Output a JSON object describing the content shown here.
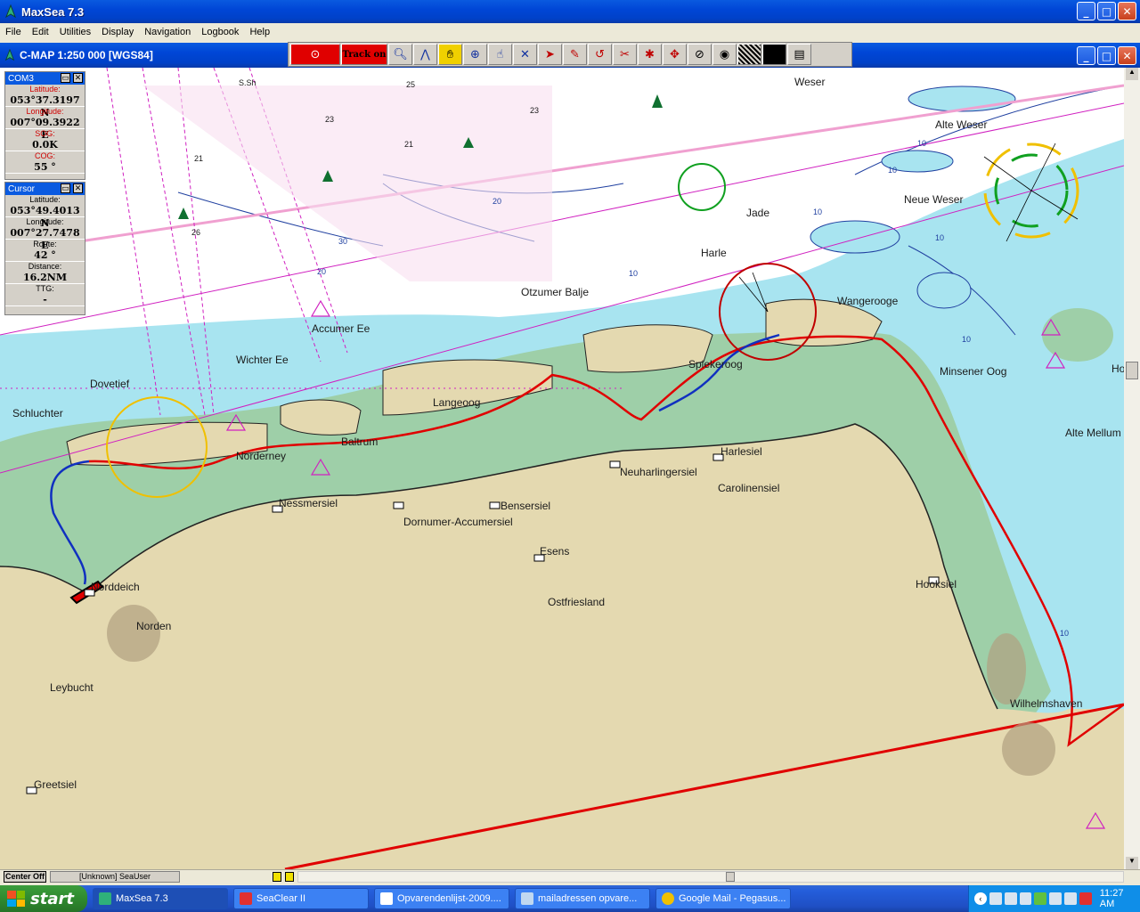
{
  "window": {
    "title": "MaxSea 7.3",
    "minimize": "_",
    "maximize": "□",
    "close": "✕"
  },
  "menu": [
    "File",
    "Edit",
    "Utilities",
    "Display",
    "Navigation",
    "Logbook",
    "Help"
  ],
  "child_window": {
    "title": "C-MAP  1:250 000 [WGS84]"
  },
  "toolbar": {
    "track_label": "Track on"
  },
  "com_panel": {
    "title": "COM3",
    "latitude_label": "Latitude:",
    "latitude": "053°37.3197 N",
    "longitude_label": "Longitude:",
    "longitude": "007°09.3922 E",
    "sog_label": "SOG:",
    "sog": "0.0K",
    "cog_label": "COG:",
    "cog": "55 °"
  },
  "cursor_panel": {
    "title": "Cursor",
    "latitude_label": "Latitude:",
    "latitude": "053°49.4013 N",
    "longitude_label": "Longitude:",
    "longitude": "007°27.7478 E",
    "route_label": "Route:",
    "route": "42 °",
    "distance_label": "Distance:",
    "distance": "16.2NM",
    "ttg_label": "TTG:",
    "ttg": "-"
  },
  "map_labels": {
    "weser": "Weser",
    "alte_weser": "Alte Weser",
    "neue_weser": "Neue Weser",
    "jade": "Jade",
    "harle": "Harle",
    "wangerooge": "Wangerooge",
    "otzumer_balje": "Otzumer Balje",
    "accumer_ee": "Accumer Ee",
    "wichter_ee": "Wichter Ee",
    "dovetief": "Dovetief",
    "schluchter": "Schluchter",
    "langeoog": "Langeoog",
    "spiekeroog": "Spiekeroog",
    "minsener_oog": "Minsener Oog",
    "baltrum": "Baltrum",
    "norderney": "Norderney",
    "harlesiel": "Harlesiel",
    "neuharlingersiel": "Neuharlingersiel",
    "carolinensiel": "Carolinensiel",
    "nessmersiel": "Nessmersiel",
    "bensersiel": "Bensersiel",
    "dornumer": "Dornumer-Accumersiel",
    "esens": "Esens",
    "ostfriesland": "Ostfriesland",
    "norddeich": "Norddeich",
    "norden": "Norden",
    "hooksiel": "Hooksiel",
    "alte_mellum": "Alte Mellum",
    "leybucht": "Leybucht",
    "wilhelmshaven": "Wilhelmshaven",
    "greetsiel": "Greetsiel",
    "ho": "Ho",
    "ssh": "S.Sh"
  },
  "depths": [
    "25",
    "23",
    "21",
    "23",
    "21",
    "26",
    "20",
    "30",
    "20",
    "10",
    "10",
    "10",
    "10",
    "10",
    "10",
    "10"
  ],
  "status": {
    "center_off": "Center Off",
    "user": "[Unknown] SeaUser"
  },
  "taskbar": {
    "start": "start",
    "tasks": [
      "MaxSea 7.3",
      "SeaClear II",
      "Opvarendenlijst-2009....",
      "mailadressen opvare...",
      "Google Mail - Pegasus..."
    ],
    "clock": "11:27 AM"
  },
  "colors": {
    "land": "#e4d9b0",
    "intertidal": "#9ecfa8",
    "shallow_water": "#a8e4f0",
    "deep_water": "#ffffff",
    "track": "#e00000",
    "route": "#1030c0",
    "chart_lines": "#d020c0",
    "titlebar": "#0046d6"
  }
}
